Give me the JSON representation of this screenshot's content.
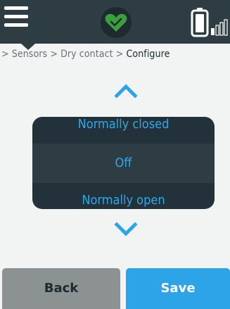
{
  "header": {
    "menu_icon": "hamburger-menu-icon",
    "status_icon": "heart-check-icon",
    "battery_icon": "battery-signal-icon",
    "colors": {
      "background": "#2e3c43",
      "status_green": "#3b9e3f"
    }
  },
  "breadcrumb": {
    "sep": ">",
    "items": [
      "Sensors",
      "Dry contact"
    ],
    "current": "Configure"
  },
  "picker": {
    "up_icon": "chevron-up-icon",
    "down_icon": "chevron-down-icon",
    "options": [
      "Normally closed",
      "Off",
      "Normally open"
    ],
    "selected": "Off"
  },
  "actions": {
    "back_label": "Back",
    "save_label": "Save"
  },
  "colors": {
    "accent": "#2ea4e8",
    "picker_bg": "#22313a",
    "back_button": "#8c9192"
  }
}
